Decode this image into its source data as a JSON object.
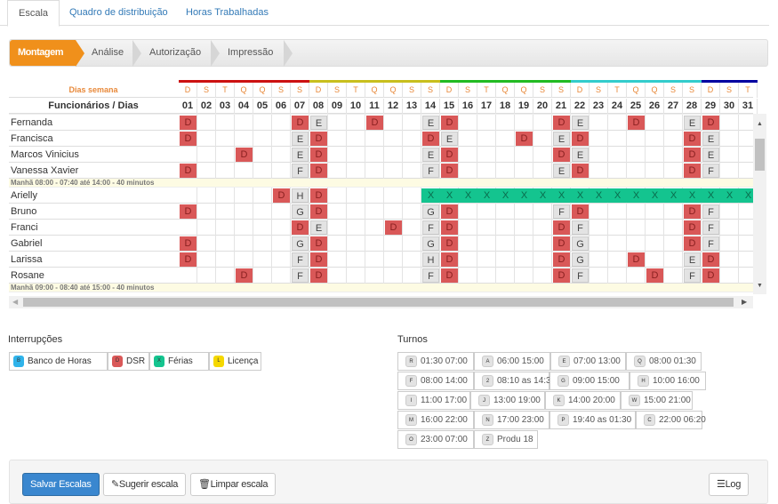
{
  "tabs": [
    {
      "label": "Escala",
      "active": true
    },
    {
      "label": "Quadro de distribuição"
    },
    {
      "label": "Horas Trabalhadas"
    }
  ],
  "steps": [
    {
      "label": "Montagem",
      "active": true
    },
    {
      "label": "Análise"
    },
    {
      "label": "Autorização"
    },
    {
      "label": "Impressão"
    }
  ],
  "grid": {
    "weekday_header": "Dias semana",
    "days_header": "Funcionários / Dias",
    "weekdays": [
      "D",
      "S",
      "T",
      "Q",
      "Q",
      "S",
      "S",
      "D",
      "S",
      "T",
      "Q",
      "Q",
      "S",
      "S",
      "D",
      "S",
      "T",
      "Q",
      "Q",
      "S",
      "S",
      "D",
      "S",
      "T",
      "Q",
      "Q",
      "S",
      "S",
      "D",
      "S",
      "T"
    ],
    "days": [
      "01",
      "02",
      "03",
      "04",
      "05",
      "06",
      "07",
      "08",
      "09",
      "10",
      "11",
      "12",
      "13",
      "14",
      "15",
      "16",
      "17",
      "18",
      "19",
      "20",
      "21",
      "22",
      "23",
      "24",
      "25",
      "26",
      "27",
      "28",
      "29",
      "30",
      "31"
    ],
    "week_colors": [
      "#cc1111",
      "#c8bf1e",
      "#22bb22",
      "#33cccc",
      "#0000a0"
    ],
    "groups": [
      {
        "label": "Manhã 07:00 - 06:40 até 13:00 - 40 minutos",
        "rows": [
          {
            "name": "Fernanda",
            "cells": {
              "01": "D",
              "07": "D",
              "08": "E",
              "11": "D",
              "14": "E",
              "15": "D",
              "21": "D",
              "22": "E",
              "25": "D",
              "28": "E",
              "29": "D"
            }
          },
          {
            "name": "Francisca",
            "cells": {
              "01": "D",
              "07": "E",
              "08": "D",
              "14": "D",
              "15": "E",
              "19": "D",
              "21": "E",
              "22": "D",
              "28": "D",
              "29": "E"
            }
          },
          {
            "name": "Marcos Vinicius",
            "cells": {
              "04": "D",
              "07": "E",
              "08": "D",
              "14": "E",
              "15": "D",
              "21": "D",
              "22": "E",
              "28": "D",
              "29": "E"
            }
          },
          {
            "name": "Vanessa Xavier",
            "cells": {
              "01": "D",
              "07": "F",
              "08": "D",
              "14": "F",
              "15": "D",
              "21": "E",
              "22": "D",
              "28": "D",
              "29": "F"
            }
          }
        ]
      },
      {
        "label": "Manhã 08:00 - 07:40 até 14:00 - 40 minutos",
        "rows": [
          {
            "name": "Arielly",
            "cells": {
              "06": "D",
              "07": "H",
              "08": "D",
              "14": "X",
              "15": "X",
              "16": "X",
              "17": "X",
              "18": "X",
              "19": "X",
              "20": "X",
              "21": "X",
              "22": "X",
              "23": "X",
              "24": "X",
              "25": "X",
              "26": "X",
              "27": "X",
              "28": "X",
              "29": "X",
              "30": "X",
              "31": "X"
            }
          },
          {
            "name": "Bruno",
            "cells": {
              "01": "D",
              "07": "G",
              "08": "D",
              "14": "G",
              "15": "D",
              "21": "F",
              "22": "D",
              "28": "D",
              "29": "F"
            }
          },
          {
            "name": "Franci",
            "cells": {
              "07": "D",
              "08": "E",
              "12": "D",
              "14": "F",
              "15": "D",
              "21": "D",
              "22": "F",
              "28": "D",
              "29": "F"
            }
          },
          {
            "name": "Gabriel",
            "cells": {
              "01": "D",
              "07": "G",
              "08": "D",
              "14": "G",
              "15": "D",
              "21": "D",
              "22": "G",
              "28": "D",
              "29": "F"
            }
          },
          {
            "name": "Larissa",
            "cells": {
              "01": "D",
              "07": "F",
              "08": "D",
              "14": "H",
              "15": "D",
              "21": "D",
              "22": "G",
              "25": "D",
              "28": "E",
              "29": "D"
            }
          },
          {
            "name": "Rosane",
            "cells": {
              "04": "D",
              "07": "F",
              "08": "D",
              "14": "F",
              "15": "D",
              "21": "D",
              "22": "F",
              "26": "D",
              "28": "F",
              "29": "D"
            }
          }
        ]
      },
      {
        "label": "Manhã 09:00 - 08:40 até 15:00 - 40 minutos",
        "rows": []
      }
    ]
  },
  "interrupcoes": {
    "title": "Interrupções",
    "items": [
      {
        "code": "B",
        "label": "Banco de Horas",
        "color": "#2fb3ea"
      },
      {
        "code": "D",
        "label": "DSR",
        "color": "#d95858"
      },
      {
        "code": "X",
        "label": "Férias",
        "color": "#14c48f"
      },
      {
        "code": "L",
        "label": "Licença",
        "color": "#f5d800"
      }
    ]
  },
  "turnos": {
    "title": "Turnos",
    "rows": [
      [
        {
          "code": "R",
          "label": "01:30 07:00"
        },
        {
          "code": "A",
          "label": "06:00 15:00"
        },
        {
          "code": "E",
          "label": "07:00 13:00"
        },
        {
          "code": "Q",
          "label": "08:00 01:30"
        }
      ],
      [
        {
          "code": "F",
          "label": "08:00 14:00"
        },
        {
          "code": "2",
          "label": "08:10 as 14:30"
        },
        {
          "code": "G",
          "label": "09:00 15:00"
        },
        {
          "code": "H",
          "label": "10:00 16:00"
        }
      ],
      [
        {
          "code": "I",
          "label": "11:00 17:00"
        },
        {
          "code": "J",
          "label": "13:00 19:00"
        },
        {
          "code": "K",
          "label": "14:00 20:00"
        },
        {
          "code": "W",
          "label": "15:00 21:00"
        }
      ],
      [
        {
          "code": "M",
          "label": "16:00 22:00"
        },
        {
          "code": "N",
          "label": "17:00 23:00"
        },
        {
          "code": "P",
          "label": "19:40 as 01:30"
        },
        {
          "code": "C",
          "label": "22:00 06:20"
        }
      ],
      [
        {
          "code": "O",
          "label": "23:00 07:00"
        },
        {
          "code": "Z",
          "label": "Produ 18"
        }
      ]
    ]
  },
  "actions": {
    "save": "Salvar Escalas",
    "suggest": "Sugerir escala",
    "clear": "Limpar escala",
    "log": "Log"
  }
}
